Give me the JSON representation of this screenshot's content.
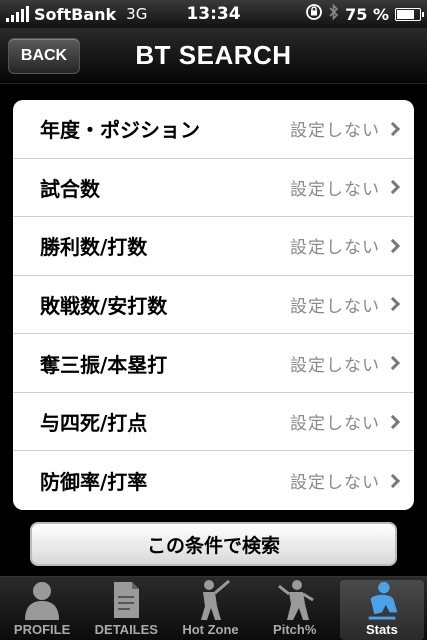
{
  "status_bar": {
    "carrier": "SoftBank",
    "network": "3G",
    "time": "13:34",
    "battery_percent": "75 %",
    "battery_level": 0.75
  },
  "nav": {
    "back_label": "BACK",
    "title": "BT SEARCH"
  },
  "filters": [
    {
      "label": "年度・ポジション",
      "value": "設定しない"
    },
    {
      "label": "試合数",
      "value": "設定しない"
    },
    {
      "label": "勝利数/打数",
      "value": "設定しない"
    },
    {
      "label": "敗戦数/安打数",
      "value": "設定しない"
    },
    {
      "label": "奪三振/本塁打",
      "value": "設定しない"
    },
    {
      "label": "与四死/打点",
      "value": "設定しない"
    },
    {
      "label": "防御率/打率",
      "value": "設定しない"
    }
  ],
  "search_button": "この条件で検索",
  "tabs": [
    {
      "label": "PROFILE",
      "icon": "person-silhouette-icon",
      "active": false
    },
    {
      "label": "DETAILES",
      "icon": "document-icon",
      "active": false
    },
    {
      "label": "Hot Zone",
      "icon": "batter-icon",
      "active": false
    },
    {
      "label": "Pitch%",
      "icon": "pitcher-icon",
      "active": false
    },
    {
      "label": "Stats",
      "icon": "stats-player-icon",
      "active": true
    }
  ],
  "colors": {
    "active_tab_icon": "#4aa3e8",
    "inactive_tab_icon": "#9a9a9a"
  }
}
